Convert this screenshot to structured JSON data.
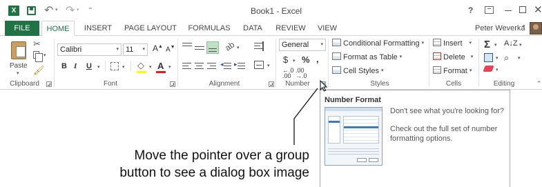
{
  "titlebar": {
    "app_icon_label": "X",
    "customize_glyph": "⁼",
    "title": "Book1 - Excel",
    "help": "?",
    "close": "✕"
  },
  "tabs": {
    "file": "FILE",
    "items": [
      "HOME",
      "INSERT",
      "PAGE LAYOUT",
      "FORMULAS",
      "DATA",
      "REVIEW",
      "VIEW"
    ],
    "active": "HOME",
    "user_name": "Peter Weverka"
  },
  "colors": {
    "excel_green": "#217346",
    "fill_yellow": "#ffff00",
    "font_red": "#e0201b",
    "highlight_green": "#bfe0c5"
  },
  "clipboard": {
    "group_label": "Clipboard",
    "paste_label": "Paste"
  },
  "font": {
    "group_label": "Font",
    "font_name": "Calibri",
    "font_size": "11",
    "bold": "B",
    "italic": "I",
    "underline": "U",
    "grow": "A",
    "shrink": "A",
    "font_color": "A"
  },
  "alignment": {
    "group_label": "Alignment"
  },
  "number": {
    "group_label": "Number",
    "format": "General",
    "currency": "$",
    "percent": "%",
    "comma": ",",
    "inc_decimal": "←.0\n.00",
    "dec_decimal": ".00\n→.0"
  },
  "styles": {
    "group_label": "Styles",
    "conditional": "Conditional Formatting",
    "table": "Format as Table",
    "cell_styles": "Cell Styles"
  },
  "cells": {
    "group_label": "Cells",
    "insert": "Insert",
    "delete": "Delete",
    "format": "Format"
  },
  "editing": {
    "group_label": "Editing",
    "sum": "Σ",
    "sort": "A↓Z"
  },
  "tooltip": {
    "title": "Number Format",
    "line1": "Don't see what you're looking for?",
    "line2": "Check out the full set of number formatting options."
  },
  "callout": {
    "line1": "Move the pointer over a group",
    "line2": "button to see a dialog box image"
  },
  "icons": [
    "excel-icon",
    "save-icon",
    "undo-icon",
    "redo-icon",
    "help-icon",
    "ribbon-options-icon",
    "minimize-icon",
    "maximize-icon",
    "close-icon",
    "paste-icon",
    "cut-icon",
    "copy-icon",
    "format-painter-icon",
    "borders-icon",
    "fill-color-icon",
    "font-color-icon",
    "wrap-text-icon",
    "merge-icon",
    "orientation-icon",
    "conditional-formatting-icon",
    "format-as-table-icon",
    "cell-styles-icon",
    "insert-cells-icon",
    "delete-cells-icon",
    "format-cells-icon",
    "autosum-icon",
    "sort-filter-icon",
    "fill-icon",
    "find-select-icon",
    "clear-icon",
    "dialog-launcher-icon"
  ]
}
